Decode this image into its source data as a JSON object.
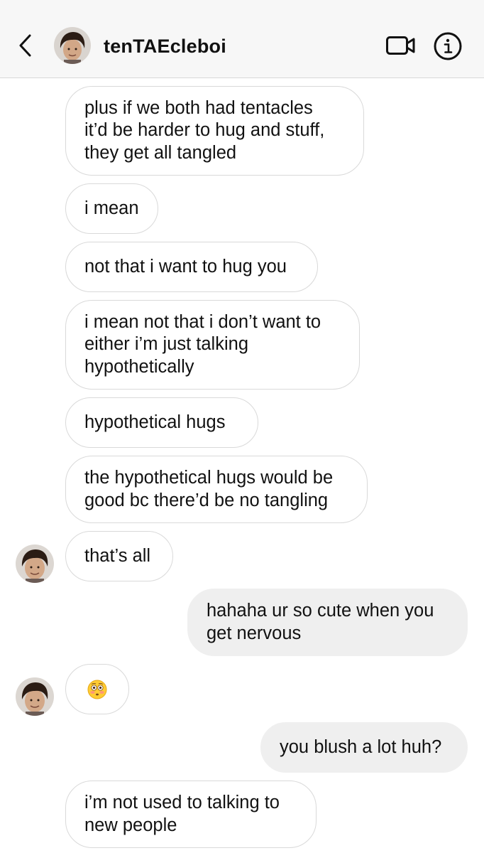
{
  "header": {
    "username": "tenTAEcleboi",
    "icons": {
      "back": "chevron-left-icon",
      "video": "video-camera-icon",
      "info": "info-icon"
    }
  },
  "messages": [
    {
      "direction": "incoming",
      "text": "plus if we both had tentacles\nit’d be harder to hug and stuff,\nthey get all tangled"
    },
    {
      "direction": "incoming",
      "text": "i mean"
    },
    {
      "direction": "incoming",
      "text": "not that i want to hug you"
    },
    {
      "direction": "incoming",
      "text": "i mean not that i don’t want to\neither i’m just talking\nhypothetically"
    },
    {
      "direction": "incoming",
      "text": "hypothetical hugs"
    },
    {
      "direction": "incoming",
      "text": "the hypothetical hugs would be\ngood bc there’d be no tangling"
    },
    {
      "direction": "incoming",
      "text": "that’s all",
      "avatar": true
    },
    {
      "direction": "outgoing",
      "text": "hahaha ur so cute when you\nget nervous"
    },
    {
      "direction": "incoming",
      "emoji": "flushed-face-emoji",
      "avatar": true
    },
    {
      "direction": "outgoing",
      "text": "you blush a lot huh?"
    },
    {
      "direction": "incoming",
      "text": "i’m not used to talking to\nnew people"
    }
  ],
  "colors": {
    "header_bg": "#f7f7f7",
    "incoming_border": "#d9d9d9",
    "outgoing_bg": "#efefef"
  }
}
